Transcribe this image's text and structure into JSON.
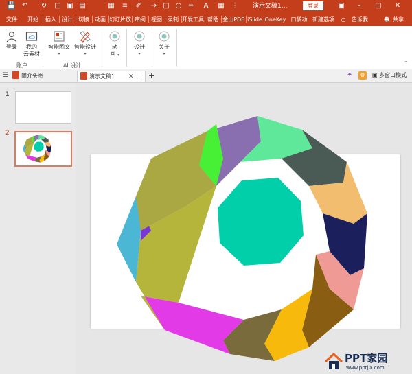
{
  "titlebar": {
    "doc_title": "演示文稿1...",
    "login": "登录",
    "icons": [
      "save-icon",
      "undo-icon",
      "redo-icon",
      "new-icon",
      "open-icon",
      "print-icon"
    ]
  },
  "tabs": [
    {
      "label": "文件",
      "active": false
    },
    {
      "label": "开始",
      "active": false
    },
    {
      "label": "插入",
      "active": false
    },
    {
      "label": "设计",
      "active": false
    },
    {
      "label": "切换",
      "active": false
    },
    {
      "label": "动画",
      "active": false
    },
    {
      "label": "幻灯片放",
      "active": false
    },
    {
      "label": "审阅",
      "active": false
    },
    {
      "label": "视图",
      "active": false
    },
    {
      "label": "录制",
      "active": false
    },
    {
      "label": "开发工具",
      "active": false
    },
    {
      "label": "帮助",
      "active": false
    },
    {
      "label": "金山PDF",
      "active": false
    },
    {
      "label": "iSlide",
      "active": false
    },
    {
      "label": "OneKey",
      "active": false
    },
    {
      "label": "口袋动",
      "active": true
    },
    {
      "label": "新建选项",
      "active": false
    }
  ],
  "tell_me": "告诉我",
  "share": "共享",
  "ribbon": {
    "login": "登录",
    "my_cloud_line1": "我的",
    "my_cloud_line2": "云素材",
    "group_account": "账户",
    "smart_graphic": "智能图文",
    "smart_design": "智能设计",
    "group_ai": "AI 设计",
    "anim_line1": "动",
    "anim_line2": "画",
    "design": "设计",
    "about": "关于"
  },
  "doctabs": {
    "tab1": "简介头图",
    "tab2": "演示文稿1",
    "new_tab": "+",
    "multi_window": "多窗口模式"
  },
  "slides": [
    {
      "number": "1"
    },
    {
      "number": "2"
    }
  ],
  "shapes": {
    "colors": [
      "#00cfaa",
      "#4bb7d4",
      "#7a36d6",
      "#e33ae8",
      "#a9a843",
      "#5b3c99",
      "#86c5c9",
      "#f6c73d",
      "#d29d92"
    ]
  },
  "watermark": {
    "title": "PPT家园",
    "url": "www.pptjia.com"
  }
}
